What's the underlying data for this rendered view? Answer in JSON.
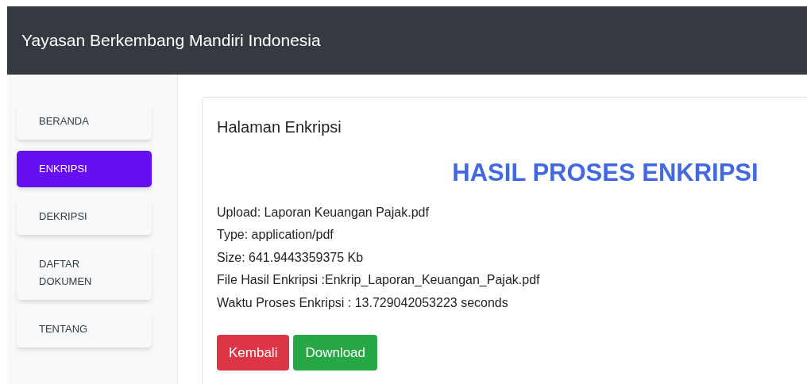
{
  "navbar": {
    "title": "Yayasan Berkembang Mandiri Indonesia"
  },
  "sidebar": {
    "items": [
      {
        "label": "BERANDA",
        "selected": false
      },
      {
        "label": "ENKRIPSI",
        "selected": true
      },
      {
        "label": "DEKRIPSI",
        "selected": false
      },
      {
        "label": "DAFTAR DOKUMEN",
        "selected": false
      },
      {
        "label": "TENTANG",
        "selected": false
      }
    ]
  },
  "card": {
    "title": "Halaman Enkripsi",
    "heading": "HASIL PROSES ENKRIPSI",
    "details": [
      "Upload: Laporan Keuangan Pajak.pdf",
      "Type: application/pdf",
      "Size: 641.9443359375 Kb",
      "File Hasil Enkripsi :Enkrip_Laporan_Keuangan_Pajak.pdf",
      "Waktu Proses Enkripsi : 13.729042053223 seconds"
    ],
    "buttons": [
      {
        "label": "Kembali",
        "kind": "danger"
      },
      {
        "label": "Download",
        "kind": "success"
      }
    ]
  }
}
